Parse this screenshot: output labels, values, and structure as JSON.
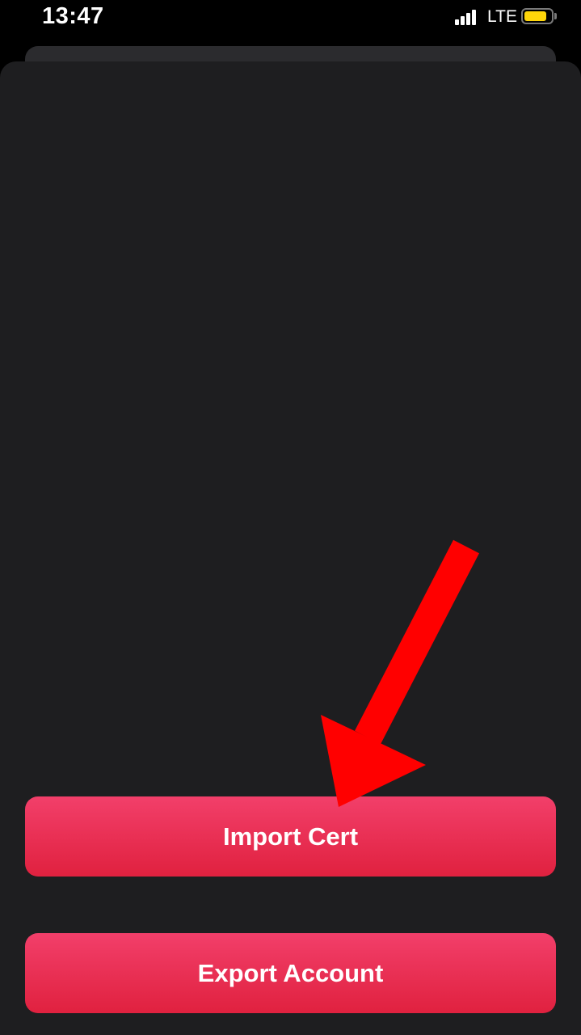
{
  "status_bar": {
    "time": "13:47",
    "network": "LTE",
    "signal_bars": 4,
    "battery_level": 0.85,
    "battery_color": "#ffd60a",
    "signal_icon": "cellular-signal-icon",
    "battery_icon": "battery-icon"
  },
  "actions": {
    "import_label": "Import Cert",
    "export_label": "Export Account"
  },
  "colors": {
    "accent_top": "#f23f6a",
    "accent_bottom": "#e0213f",
    "sheet": "#1e1e20",
    "annotation": "#ff0000"
  },
  "annotation": {
    "type": "arrow",
    "points_to": "Import Cert"
  }
}
